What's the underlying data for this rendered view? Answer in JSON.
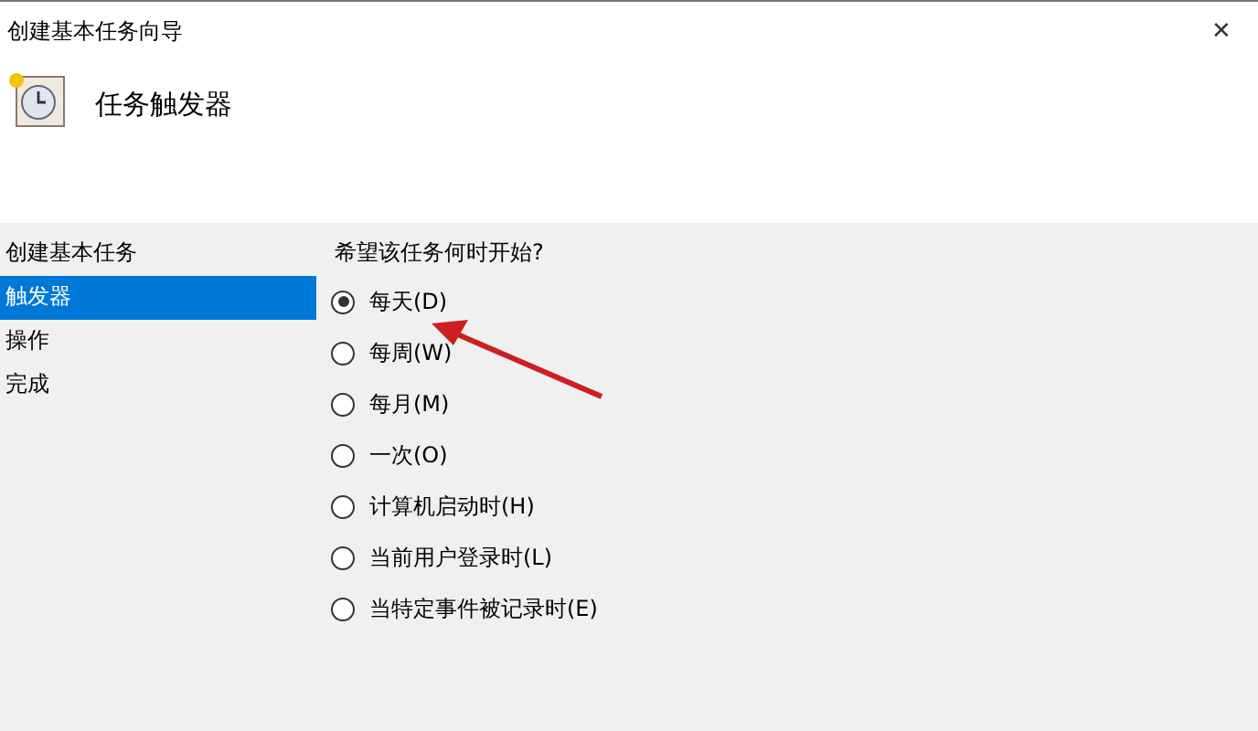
{
  "window": {
    "title": "创建基本任务向导",
    "close": "✕"
  },
  "header": {
    "title": "任务触发器"
  },
  "sidebar": {
    "items": [
      {
        "label": "创建基本任务",
        "selected": false
      },
      {
        "label": "触发器",
        "selected": true
      },
      {
        "label": "操作",
        "selected": false
      },
      {
        "label": "完成",
        "selected": false
      }
    ]
  },
  "content": {
    "question": "希望该任务何时开始?",
    "options": [
      {
        "label": "每天(D)",
        "selected": true
      },
      {
        "label": "每周(W)",
        "selected": false
      },
      {
        "label": "每月(M)",
        "selected": false
      },
      {
        "label": "一次(O)",
        "selected": false
      },
      {
        "label": "计算机启动时(H)",
        "selected": false
      },
      {
        "label": "当前用户登录时(L)",
        "selected": false
      },
      {
        "label": "当特定事件被记录时(E)",
        "selected": false
      }
    ]
  }
}
